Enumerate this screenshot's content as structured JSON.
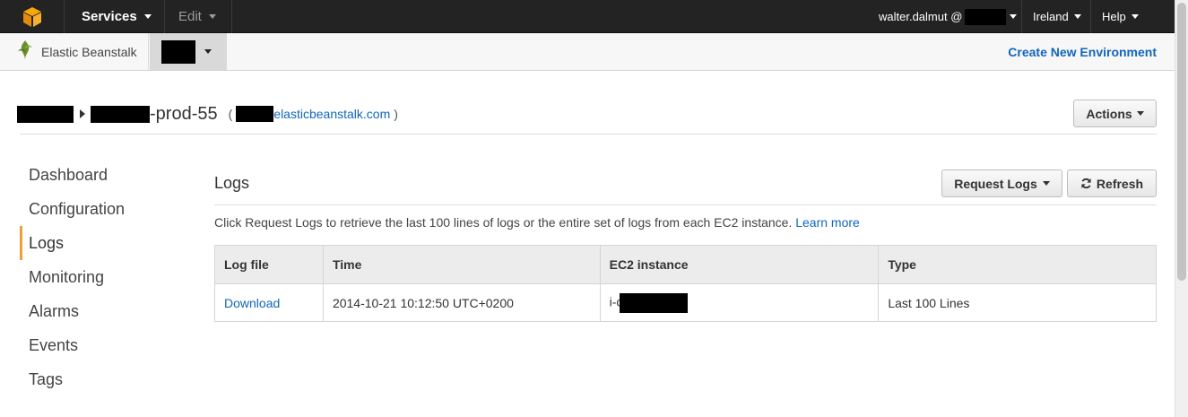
{
  "topbar": {
    "logo_icon": "aws-cube-icon",
    "services_label": "Services",
    "edit_label": "Edit",
    "user_label": "walter.dalmut @",
    "region_label": "Ireland",
    "help_label": "Help"
  },
  "subnav": {
    "home_icon": "elastic-beanstalk-icon",
    "home_label": "Elastic Beanstalk",
    "create_env_label": "Create New Environment"
  },
  "breadcrumb": {
    "env_suffix": "-prod-55",
    "url_open": "(",
    "url_text": "elasticbeanstalk.com",
    "url_close": ")"
  },
  "actions_label": "Actions",
  "sidemenu": {
    "items": [
      {
        "label": "Dashboard"
      },
      {
        "label": "Configuration"
      },
      {
        "label": "Logs",
        "active": true
      },
      {
        "label": "Monitoring"
      },
      {
        "label": "Alarms"
      },
      {
        "label": "Events"
      },
      {
        "label": "Tags"
      }
    ]
  },
  "logs": {
    "title": "Logs",
    "request_label": "Request Logs",
    "refresh_label": "Refresh",
    "description": "Click Request Logs to retrieve the last 100 lines of logs or the entire set of logs from each EC2 instance.",
    "learn_more": "Learn more",
    "columns": [
      "Log file",
      "Time",
      "EC2 instance",
      "Type"
    ],
    "rows": [
      {
        "log_file": "Download",
        "time": "2014-10-21 10:12:50 UTC+0200",
        "instance_prefix": "i-c",
        "type": "Last 100 Lines"
      }
    ]
  },
  "colors": {
    "topbar_bg": "#232323",
    "link": "#1166bb",
    "active_accent": "#f0a030"
  }
}
